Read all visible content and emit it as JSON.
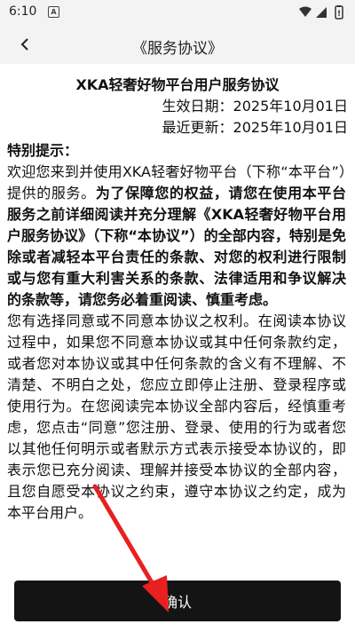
{
  "status_bar": {
    "time": "6:10",
    "notification_letter": "A"
  },
  "nav": {
    "title": "《服务协议》"
  },
  "doc": {
    "title": "XKA轻奢好物平台用户服务协议",
    "effective_date": "生效日期：2025年10月01日",
    "updated_date": "最近更新：2025年10月01日",
    "heading_tips": "特别提示：",
    "p1_normal": "欢迎您来到并使用XKA轻奢好物平台（下称“本平台”）提供的服务。",
    "p1_bold": "为了保障您的权益，请您在使用本平台服务之前详细阅读并充分理解《XKA轻奢好物平台用户服务协议》（下称“本协议”）的全部内容，特别是免除或者减轻本平台责任的条款、对您的权利进行限制或与您有重大利害关系的条款、法律适用和争议解决的条款等，请您务必着重阅读、慎重考虑。",
    "p2": "您有选择同意或不同意本协议之权利。在阅读本协议过程中，如果您不同意本协议或其中任何条款约定，或者您对本协议或其中任何条款的含义有不理解、不清楚、不明白之处，您应立即停止注册、登录程序或使用行为。在您阅读完本协议全部内容后，经慎重考虑，您点击“同意”您注册、登录、使用的行为或者您以其他任何明示或者默示方式表示接受本协议的，即表示您已充分阅读、理解并接受本协议的全部内容，且您自愿受本协议之约束，遵守本协议之约定，成为本平台用户。"
  },
  "footer": {
    "confirm_label": "确认"
  },
  "colors": {
    "button_bg": "#141414",
    "arrow": "#e8201f",
    "bar_bg": "#f3f3f3"
  }
}
